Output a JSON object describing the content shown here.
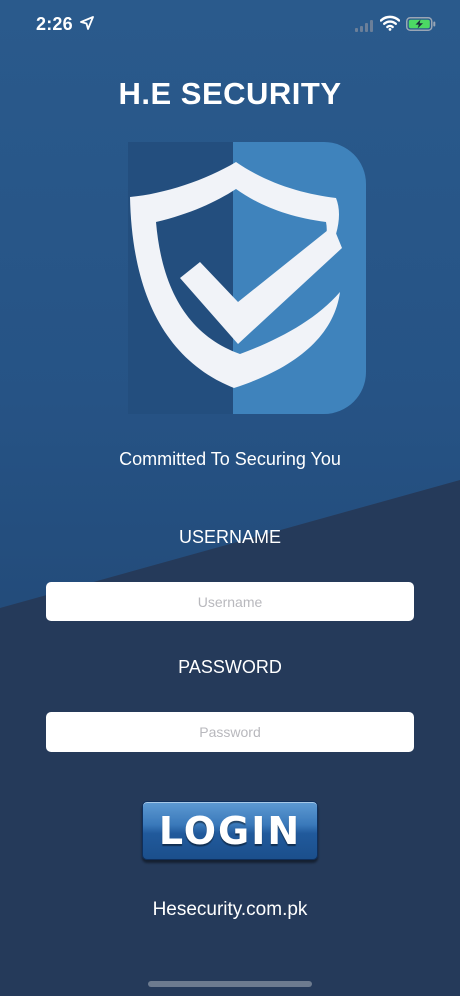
{
  "status_bar": {
    "time": "2:26",
    "location_icon": "location-arrow-icon",
    "signal_icon": "cellular-signal-icon",
    "wifi_icon": "wifi-icon",
    "battery_icon": "battery-charging-icon"
  },
  "app": {
    "title": "H.E SECURITY",
    "logo_icon": "shield-check-icon",
    "tagline": "Committed To Securing You"
  },
  "form": {
    "username_label": "USERNAME",
    "username_placeholder": "Username",
    "username_value": "",
    "password_label": "PASSWORD",
    "password_placeholder": "Password",
    "password_value": "",
    "login_label": "LOGIN"
  },
  "footer": {
    "website": "Hesecurity.com.pk"
  },
  "colors": {
    "background_top": "#265385",
    "background_bottom": "#253a5a",
    "logo_dark": "#234e7e",
    "logo_light": "#3f83bc",
    "shield_white": "#f1f3f8",
    "button_blue": "#2a66a8"
  }
}
